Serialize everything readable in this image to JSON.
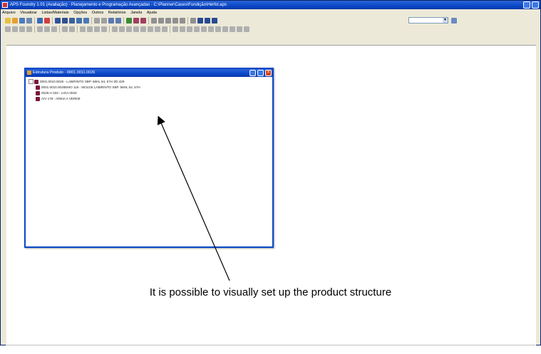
{
  "window": {
    "title": "APS Foundry 1.01 (Avaliação) · Planejamento e Programação Avançadas · C:\\Planner\\Cases\\Fundição\\Hérfol.aps",
    "buttons": [
      "_",
      "X"
    ]
  },
  "menu": {
    "items": [
      "Arquivo",
      "Visualizar",
      "Listas/Materiais",
      "Opções",
      "Outros",
      "Relatórios",
      "Janela",
      "Ajuda"
    ]
  },
  "toolbar": {
    "combo_value": ""
  },
  "child_window": {
    "title": "Estrutura Produto - 0001.0011.0026",
    "tree": [
      {
        "text": "0001.0010.0026 - LABIRINTO SBP. 58HL 54, 57H ZD.429",
        "level": 0
      },
      {
        "text": "0001.0010.0026EMO 115 - MOLDE LABIRINTO SBP. 58HL 54, 57H",
        "level": 1
      },
      {
        "text": "0029.H 333 - LIGA 0029",
        "level": 1
      },
      {
        "text": "A/V 179 - AREIA A VERDE",
        "level": 1
      }
    ]
  },
  "annotation": {
    "caption": "It is possible to visually set up the product structure"
  }
}
